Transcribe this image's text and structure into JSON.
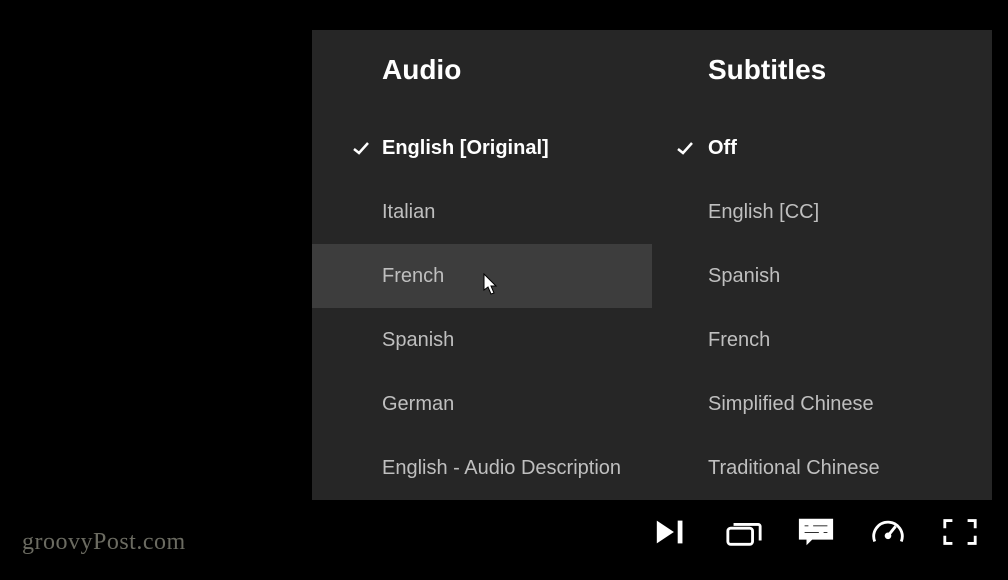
{
  "panel": {
    "audio": {
      "title": "Audio",
      "selected_index": 0,
      "hover_index": 2,
      "items": [
        "English [Original]",
        "Italian",
        "French",
        "Spanish",
        "German",
        "English - Audio Description"
      ]
    },
    "subtitles": {
      "title": "Subtitles",
      "selected_index": 0,
      "items": [
        "Off",
        "English [CC]",
        "Spanish",
        "French",
        "Simplified Chinese",
        "Traditional Chinese"
      ]
    }
  },
  "watermark": "groovyPost.com"
}
